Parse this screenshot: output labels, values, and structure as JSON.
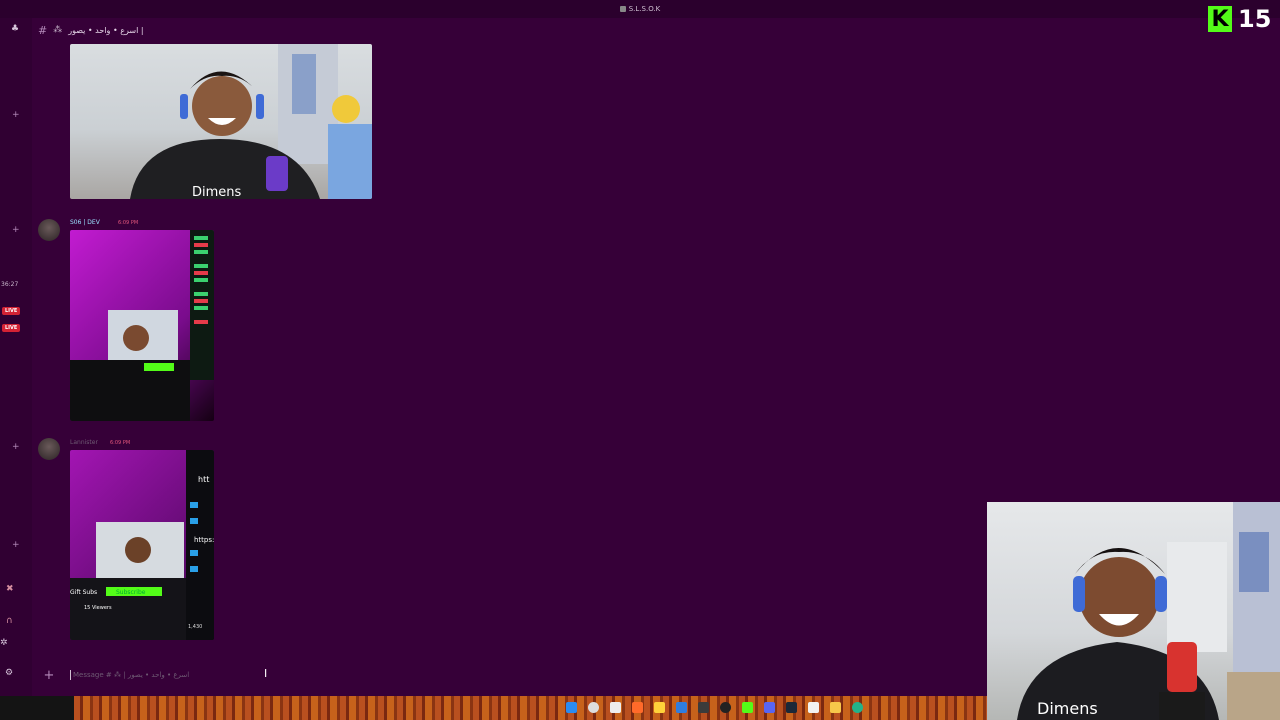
{
  "window": {
    "title": "S.L.S.O.K"
  },
  "channel": {
    "name": "اسرع • واحد • يصور |",
    "star": "⁂"
  },
  "rail": {
    "timer": "36:27",
    "live_badges": [
      "LIVE",
      "LIVE"
    ]
  },
  "messages": [
    {
      "username": "",
      "timestamp": ""
    },
    {
      "username": "S06 | DEV",
      "timestamp": "6:09 PM"
    },
    {
      "username": "Lannister",
      "timestamp": "6:09 PM"
    }
  ],
  "screenshot_texts": {
    "gift_subs": "Gift Subs",
    "subscribe": "Subscribe",
    "viewers": "15 Viewers",
    "count": "1,430",
    "https": "https:",
    "dimens": "Dimens"
  },
  "composer": {
    "placeholder": "Message # ⁂ | اسرع • واحد • يصور"
  },
  "overlay": {
    "kick_logo": "K",
    "viewer_count": "15"
  },
  "colors": {
    "background": "#360038",
    "rail": "#300032",
    "kick_green": "#53fc18",
    "live_red": "#d32234"
  }
}
